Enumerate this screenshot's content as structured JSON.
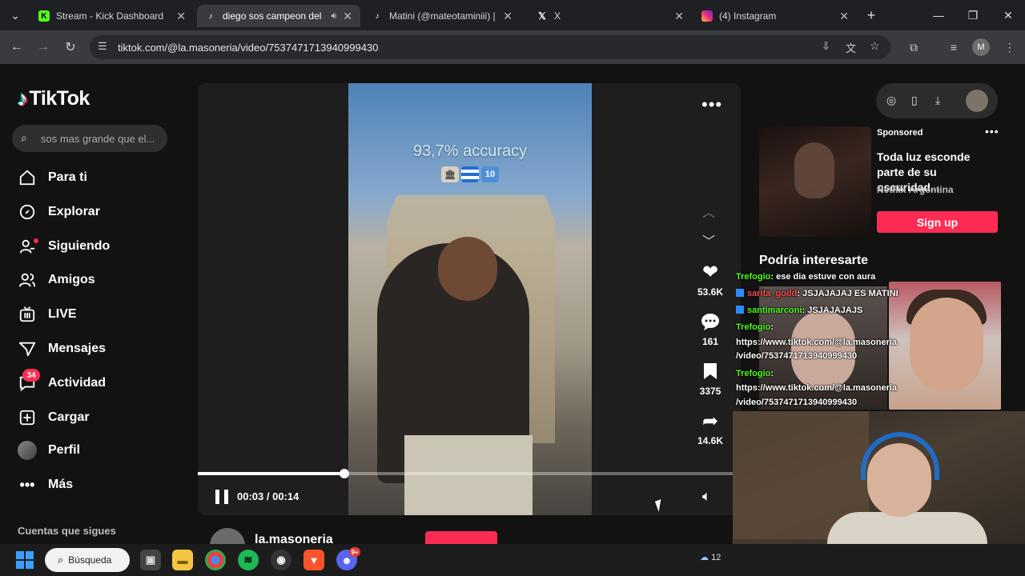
{
  "browser": {
    "tabs": [
      {
        "title": "Stream - Kick Dashboard",
        "favicon": "kick-icon",
        "color": "#53fc18",
        "active": false
      },
      {
        "title": "diego sos campeon del",
        "favicon": "tiktok-icon",
        "color": "#ffffff",
        "active": true
      },
      {
        "title": "Matini (@mateotaminiii) | Ti",
        "favicon": "tiktok-icon",
        "color": "#ffffff",
        "active": false
      },
      {
        "title": "X",
        "favicon": "x-icon",
        "color": "#ffffff",
        "active": false
      },
      {
        "title": "(4) Instagram",
        "favicon": "instagram-icon",
        "color": "#e1306c",
        "active": false
      }
    ],
    "url": "tiktok.com/@la.masoneria/video/7537471713940999430",
    "profile_initial": "M"
  },
  "tiktok": {
    "logo_text": "TikTok",
    "search_placeholder": "sos mas grande que el...",
    "nav": [
      {
        "label": "Para ti",
        "icon": "home-icon"
      },
      {
        "label": "Explorar",
        "icon": "compass-icon"
      },
      {
        "label": "Siguiendo",
        "icon": "following-icon"
      },
      {
        "label": "Amigos",
        "icon": "friends-icon"
      },
      {
        "label": "LIVE",
        "icon": "live-icon"
      },
      {
        "label": "Mensajes",
        "icon": "messages-icon"
      },
      {
        "label": "Actividad",
        "icon": "activity-icon",
        "badge": "34"
      },
      {
        "label": "Cargar",
        "icon": "upload-icon"
      },
      {
        "label": "Perfil",
        "icon": "profile-avatar"
      },
      {
        "label": "Más",
        "icon": "more-icon"
      }
    ],
    "following_header": "Cuentas que sigues",
    "video": {
      "overlay_text": "93,7% accuracy",
      "badge_number": "10",
      "likes": "53.6K",
      "comments": "161",
      "saves": "3375",
      "shares": "14.6K",
      "time": "00:03 / 00:14",
      "progress": 0.27,
      "author": "la.masoneria"
    },
    "ad": {
      "sponsored_label": "Sponsored",
      "title": "Toda luz esconde parte de su oscuridad...",
      "brand": "Netflix Argentina",
      "cta": "Sign up"
    },
    "suggest_header": "Podría interesarte"
  },
  "stream_chat": [
    {
      "user": "Trefogio",
      "text": ": ese dia estuve con aura",
      "style": "green",
      "icon": false
    },
    {
      "user": "sarita_godd",
      "text": ": JSJAJAJAJ ES MATINI",
      "style": "red",
      "icon": true
    },
    {
      "user": "santimarconi",
      "text": ": JSJAJAJAJS",
      "style": "green",
      "icon": true
    },
    {
      "user": "Trefogio",
      "text": ":",
      "style": "green",
      "icon": false
    },
    {
      "user": "",
      "text": "https://www.tiktok.com/@la.masoneria",
      "style": "none",
      "icon": false
    },
    {
      "user": "",
      "text": "/video/7537471713940999430",
      "style": "none",
      "icon": false
    },
    {
      "user": "Trefogio",
      "text": ":",
      "style": "green",
      "icon": false
    },
    {
      "user": "",
      "text": "https://www.tiktok.com/@la.masoneria",
      "style": "none",
      "icon": false
    },
    {
      "user": "",
      "text": "/video/7537471713940999430",
      "style": "none",
      "icon": false
    }
  ],
  "taskbar": {
    "search_label": "Búsqueda",
    "discord_badge": "9+",
    "tray_text": "12"
  }
}
